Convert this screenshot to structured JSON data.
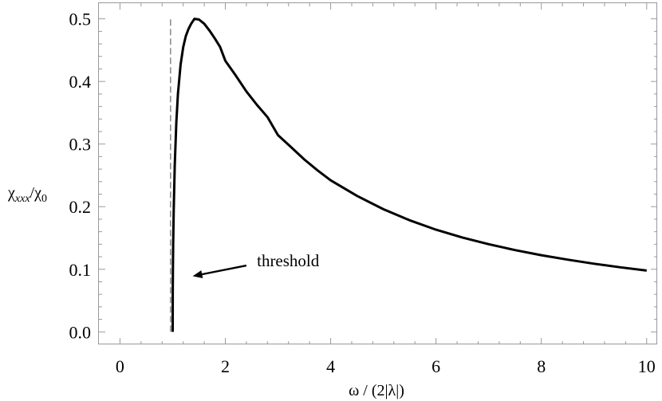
{
  "chart_data": {
    "type": "line",
    "title": "",
    "xlabel": "ω / (2|λ|)",
    "ylabel_main": "χ",
    "ylabel_sub": "xxx",
    "ylabel_div": "/χ",
    "ylabel_zero": "0",
    "xlim": [
      -0.4,
      10.2
    ],
    "ylim": [
      -0.02,
      0.525
    ],
    "x_ticks": [
      0,
      2,
      4,
      6,
      8,
      10
    ],
    "x_tick_labels": [
      "0",
      "2",
      "4",
      "6",
      "8",
      "10"
    ],
    "y_ticks": [
      0.0,
      0.1,
      0.2,
      0.3,
      0.4,
      0.5
    ],
    "y_tick_labels": [
      "0.0",
      "0.1",
      "0.2",
      "0.3",
      "0.4",
      "0.5"
    ],
    "grid": false,
    "threshold_x": 0.96,
    "threshold_y_range": [
      0.0,
      0.5
    ],
    "annotation": {
      "text": "threshold",
      "x": 2.6,
      "y": 0.105,
      "arrow_from": [
        2.4,
        0.106
      ],
      "arrow_to": [
        1.38,
        0.089
      ]
    },
    "series": [
      {
        "x": [
          1.0,
          1.002,
          1.005,
          1.01,
          1.02,
          1.04,
          1.07,
          1.1,
          1.15,
          1.2,
          1.25,
          1.3,
          1.35,
          1.414,
          1.5,
          1.6,
          1.7,
          1.8,
          1.9,
          2.0,
          2.2,
          2.4,
          2.6,
          2.8,
          3.0,
          3.25,
          3.5,
          3.75,
          4.0,
          4.5,
          5.0,
          5.5,
          6.0,
          6.5,
          7.0,
          7.5,
          8.0,
          8.5,
          9.0,
          9.5,
          10.0
        ],
        "y": [
          0.0,
          0.0632,
          0.0995,
          0.1393,
          0.1941,
          0.2663,
          0.3353,
          0.3802,
          0.4264,
          0.4549,
          0.4726,
          0.4838,
          0.492,
          0.5,
          0.4989,
          0.4922,
          0.4812,
          0.4687,
          0.4552,
          0.433,
          0.4093,
          0.384,
          0.3627,
          0.3431,
          0.3143,
          0.295,
          0.2754,
          0.258,
          0.2421,
          0.2172,
          0.196,
          0.1782,
          0.1633,
          0.1508,
          0.14,
          0.1306,
          0.1225,
          0.1153,
          0.1089,
          0.1031,
          0.0979
        ]
      }
    ]
  }
}
